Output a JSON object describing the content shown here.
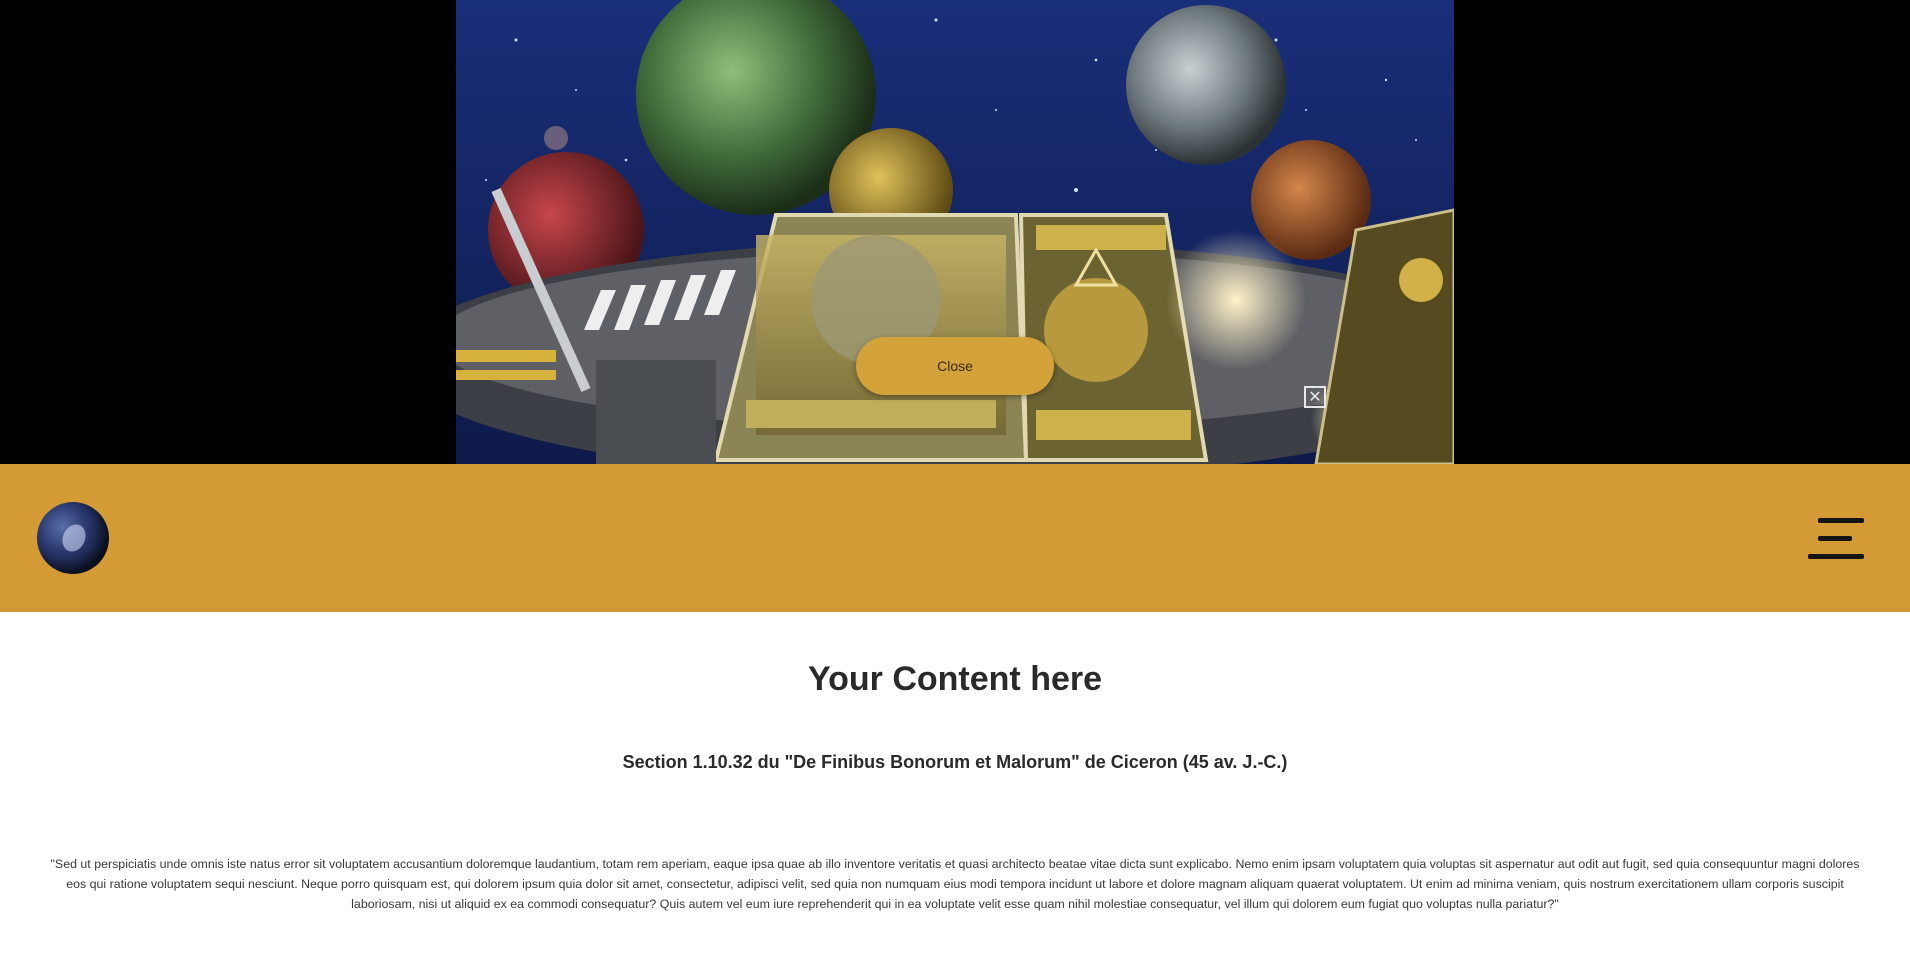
{
  "hero": {
    "close_button_label": "Close",
    "close_x_label": "✕"
  },
  "navbar": {
    "logo_icon": "planet-logo-icon",
    "menu_icon": "hamburger-menu-icon",
    "background": "#d39a36"
  },
  "content": {
    "title": "Your Content here",
    "section_heading": "Section 1.10.32 du \"De Finibus Bonorum et Malorum\" de Ciceron (45 av. J.-C.)",
    "body": "\"Sed ut perspiciatis unde omnis iste natus error sit voluptatem accusantium doloremque laudantium, totam rem aperiam, eaque ipsa quae ab illo inventore veritatis et quasi architecto beatae vitae dicta sunt explicabo. Nemo enim ipsam voluptatem quia voluptas sit aspernatur aut odit aut fugit, sed quia consequuntur magni dolores eos qui ratione voluptatem sequi nesciunt. Neque porro quisquam est, qui dolorem ipsum quia dolor sit amet, consectetur, adipisci velit, sed quia non numquam eius modi tempora incidunt ut labore et dolore magnam aliquam quaerat voluptatem. Ut enim ad minima veniam, quis nostrum exercitationem ullam corporis suscipit laboriosam, nisi ut aliquid ex ea commodi consequatur? Quis autem vel eum iure reprehenderit qui in ea voluptate velit esse quam nihil molestiae consequatur, vel illum qui dolorem eum fugiat quo voluptas nulla pariatur?\""
  }
}
